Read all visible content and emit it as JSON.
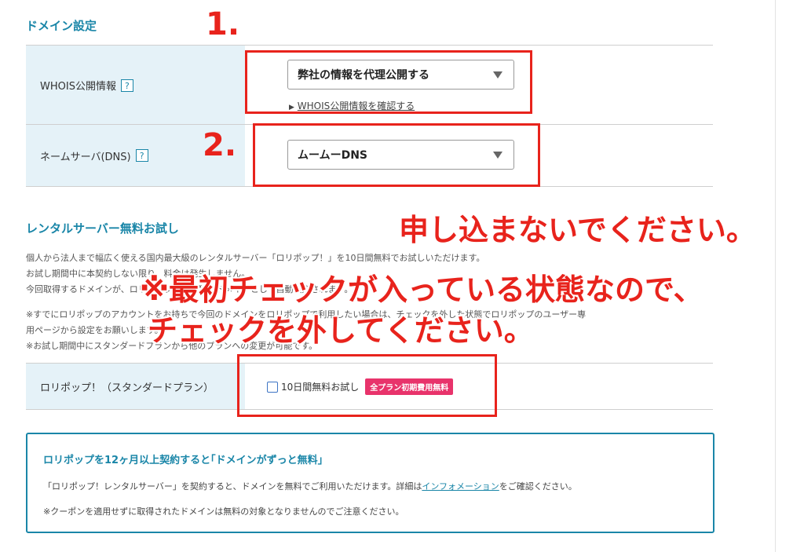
{
  "domain_settings": {
    "title": "ドメイン設定",
    "whois": {
      "label": "WHOIS公開情報",
      "help": "?",
      "selected": "弊社の情報を代理公開する",
      "link": "WHOIS公開情報を確認する",
      "link_marker": "▶"
    },
    "nameserver": {
      "label": "ネームサーバ(DNS)",
      "help": "?",
      "selected": "ムームーDNS"
    }
  },
  "rental_trial": {
    "title": "レンタルサーバー無料お試し",
    "desc_lines": [
      "個人から法人まで幅広く使える国内最大級のレンタルサーバー「ロリポップ！」を10日間無料でお試しいただけます。",
      "お試し期間中に本契約しない限り、料金は発生しません。",
      "今回取得するドメインが、ロリポップ！にて独自ドメインとして自動設定されます。",
      "※すでにロリポップのアカウントをお持ちで今回のドメインをロリポップで利用したい場合は、チェックを外した状態でロリポップのユーザー専",
      "用ページから設定をお願いします。",
      "※お試し期間中にスタンダードプランから他のプランへの変更が可能です。"
    ],
    "plan_label": "ロリポップ！（スタンダードプラン）",
    "checkbox_label": "10日間無料お試し",
    "badge": "全プラン初期費用無料"
  },
  "notice": {
    "title": "ロリポップを12ヶ月以上契約すると｢ドメインがずっと無料｣",
    "line1_before": "「ロリポップ！レンタルサーバー」を契約すると、ドメインを無料でご利用いただけます。詳細は",
    "line1_link": "インフォメーション",
    "line1_after": "をご確認ください。",
    "line2": "※クーポンを適用せずに取得されたドメインは無料の対象となりませんのでご注意ください。"
  },
  "annotations": {
    "step1": "1.",
    "step2": "2.",
    "dont_apply": "申し込まないでください。",
    "checked_line1": "※最初チェックが入っている状態なので、",
    "checked_line2": "チェックを外してください。",
    "color": "#e8231c"
  },
  "colors": {
    "accent": "#1a86a8",
    "label_bg": "#e5f2f8",
    "badge": "#e8336b"
  },
  "icons": {
    "select_caret": "triangle-down",
    "help": "question-mark"
  }
}
